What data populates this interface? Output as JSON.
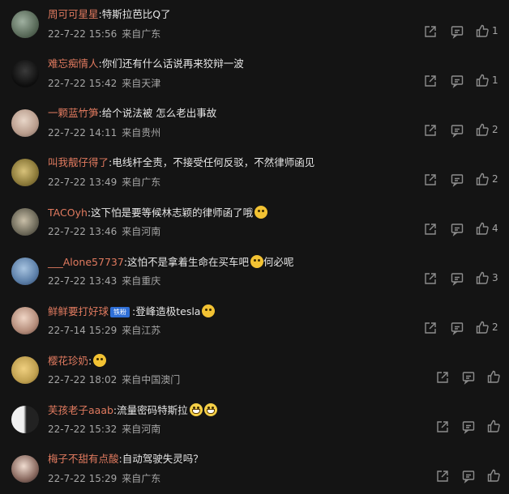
{
  "colors": {
    "username": "#e07a5f",
    "text": "#e6e6e6",
    "meta": "#a5a5a5",
    "icon": "#8d8d8d",
    "background": "#141414"
  },
  "comments": [
    {
      "username": "周可可星星",
      "text": "特斯拉芭比Q了",
      "date": "22-7-22 15:56",
      "location": "来自广东",
      "likes": "1",
      "emoji": [],
      "badge": ""
    },
    {
      "username": "难忘痴情人",
      "text": "你们还有什么话说再来狡辩一波",
      "date": "22-7-22 15:42",
      "location": "来自天津",
      "likes": "1",
      "emoji": [],
      "badge": ""
    },
    {
      "username": "一颗蓝竹笋",
      "text": "给个说法被   怎么老出事故",
      "date": "22-7-22 14:11",
      "location": "来自贵州",
      "likes": "2",
      "emoji": [],
      "badge": ""
    },
    {
      "username": "叫我靓仔得了",
      "text": "电线杆全责，不接受任何反驳，不然律师函见",
      "date": "22-7-22 13:49",
      "location": "来自广东",
      "likes": "2",
      "emoji": [],
      "badge": ""
    },
    {
      "username": "TACOyh",
      "text": "这下怕是要等候林志颖的律师函了哦",
      "date": "22-7-22 13:46",
      "location": "来自河南",
      "likes": "4",
      "emoji": [
        "doge-emoji"
      ],
      "badge": ""
    },
    {
      "username": "___Alone57737",
      "text": "这怕不是拿着生命在买车吧",
      "text_after": "何必呢",
      "date": "22-7-22 13:43",
      "location": "来自重庆",
      "likes": "3",
      "emoji": [
        "sweat-emoji"
      ],
      "badge": ""
    },
    {
      "username": "鲜鲜要打好球",
      "text": "登峰造极tesla",
      "date": "22-7-14 15:29",
      "location": "来自江苏",
      "likes": "2",
      "emoji": [
        "doge-emoji"
      ],
      "badge": "铁粉"
    },
    {
      "username": "樱花珍奶",
      "text": "",
      "date": "22-7-22 18:02",
      "location": "来自中国澳门",
      "likes": "",
      "emoji": [
        "doge-emoji"
      ],
      "badge": ""
    },
    {
      "username": "芙孩老子aaab",
      "text": "流量密码特斯拉",
      "date": "22-7-22 15:32",
      "location": "来自河南",
      "likes": "",
      "emoji": [
        "grin-emoji",
        "grin-emoji"
      ],
      "badge": ""
    },
    {
      "username": "梅子不甜有点酸",
      "text": "自动驾驶失灵吗？",
      "date": "22-7-22 15:29",
      "location": "来自广东",
      "likes": "",
      "emoji": [],
      "badge": ""
    }
  ]
}
